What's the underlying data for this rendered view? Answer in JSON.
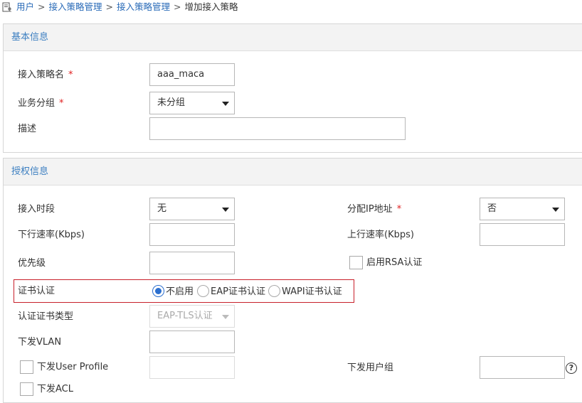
{
  "breadcrumb": {
    "icon": "user-doc-icon",
    "items": [
      "用户",
      "接入策略管理",
      "接入策略管理"
    ],
    "separator": ">",
    "current": "增加接入策略"
  },
  "basic": {
    "title": "基本信息",
    "policy_name": {
      "label": "接入策略名",
      "required": "*",
      "value": "aaa_maca"
    },
    "service_group": {
      "label": "业务分组",
      "required": "*",
      "value": "未分组"
    },
    "description": {
      "label": "描述",
      "value": ""
    }
  },
  "auth": {
    "title": "授权信息",
    "access_period": {
      "label": "接入时段",
      "value": "无"
    },
    "assign_ip": {
      "label": "分配IP地址",
      "required": "*",
      "value": "否"
    },
    "downlink_rate": {
      "label": "下行速率(Kbps)",
      "value": ""
    },
    "uplink_rate": {
      "label": "上行速率(Kbps)",
      "value": ""
    },
    "priority": {
      "label": "优先级",
      "value": ""
    },
    "rsa": {
      "label": "启用RSA认证",
      "checked": false
    },
    "cert_auth": {
      "label": "证书认证",
      "options": [
        "不启用",
        "EAP证书认证",
        "WAPI证书认证"
      ],
      "selected": 0
    },
    "cert_type": {
      "label": "认证证书类型",
      "value": "EAP-TLS认证",
      "disabled": true
    },
    "vlan": {
      "label": "下发VLAN",
      "value": ""
    },
    "user_profile": {
      "label": "下发User Profile",
      "checked": false,
      "value": ""
    },
    "user_group": {
      "label": "下发用户组",
      "value": ""
    },
    "acl": {
      "label": "下发ACL",
      "checked": false
    }
  },
  "colors": {
    "link": "#2a6bb8",
    "section_title": "#3c7fc1",
    "required": "#e02020",
    "highlight_border": "#c8202a",
    "radio_selected": "#2b6fcf"
  }
}
